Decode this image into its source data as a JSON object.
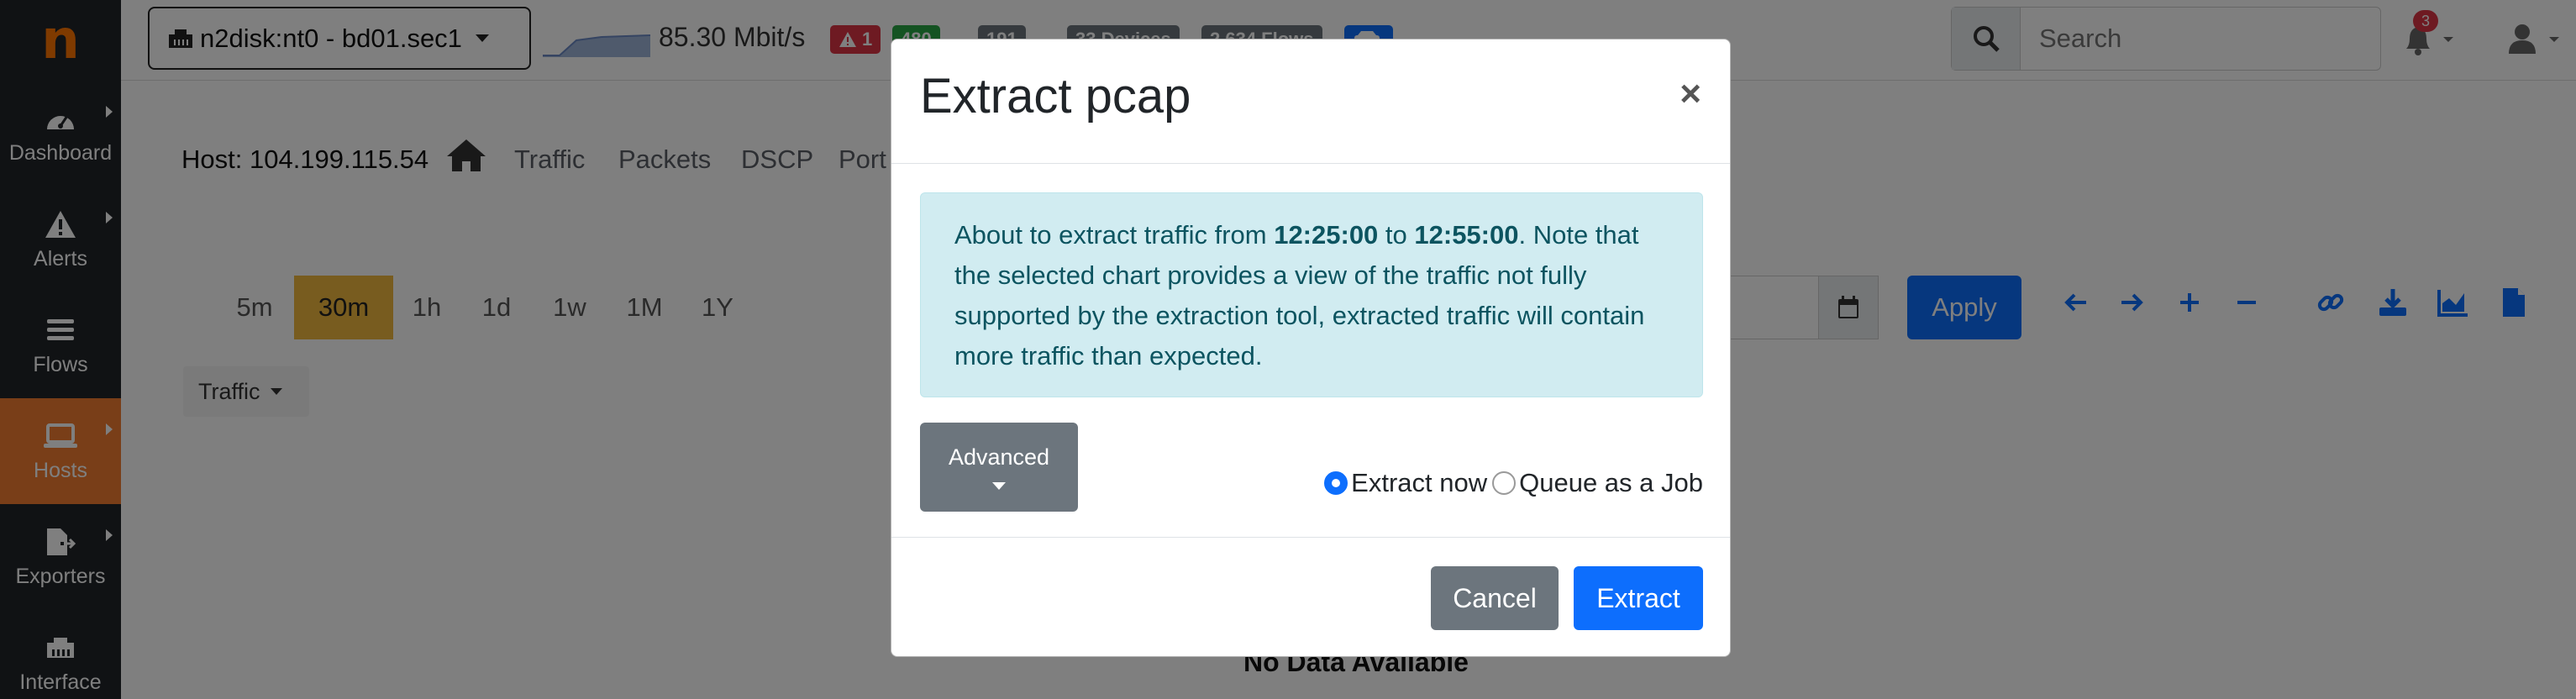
{
  "brand": {
    "logo_letter": "n",
    "color": "#ff7500"
  },
  "sidebar": {
    "items": [
      {
        "label": "Dashboard",
        "icon": "gauge-icon",
        "active": false
      },
      {
        "label": "Alerts",
        "icon": "warning-icon",
        "active": false
      },
      {
        "label": "Flows",
        "icon": "list-icon",
        "active": false
      },
      {
        "label": "Hosts",
        "icon": "laptop-icon",
        "active": true
      },
      {
        "label": "Exporters",
        "icon": "file-export-icon",
        "active": false
      },
      {
        "label": "Interface",
        "icon": "ethernet-icon",
        "active": false
      }
    ]
  },
  "topbar": {
    "interface_selector": "n2disk:nt0 - bd01.sec1",
    "throughput": "85.30 Mbit/s",
    "badges": [
      {
        "label": "1",
        "color": "#dc3545",
        "icon": "warning-icon"
      },
      {
        "label": "480",
        "color": "#28a745"
      },
      {
        "label": "191",
        "color": "#6c757d"
      },
      {
        "label": "33 Devices",
        "color": "#6c757d"
      },
      {
        "label": "2,634 Flows",
        "color": "#6c757d"
      }
    ],
    "search_placeholder": "Search",
    "notifications_count": "3"
  },
  "host": {
    "title": "Host: 104.199.115.54",
    "tabs": [
      "Traffic",
      "Packets",
      "DSCP",
      "Port"
    ]
  },
  "toolbar": {
    "ranges": [
      "5m",
      "30m",
      "1h",
      "1d",
      "1w",
      "1M",
      "1Y"
    ],
    "selected_range": "30m",
    "apply_label": "Apply",
    "traffic_dropdown": "Traffic"
  },
  "chart": {
    "no_data": "No Data Available"
  },
  "modal": {
    "title": "Extract pcap",
    "close_glyph": "×",
    "alert": {
      "prefix": "About to extract traffic from ",
      "start_time": "12:25:00",
      "middle": " to ",
      "end_time": "12:55:00",
      "suffix": ". Note that the selected chart provides a view of the traffic not fully supported by the extraction tool, extracted traffic will contain more traffic than expected."
    },
    "advanced_label": "Advanced",
    "radio_extract_now": "Extract now",
    "radio_queue_job": "Queue as a Job",
    "selected_option": "Extract now",
    "cancel_label": "Cancel",
    "extract_label": "Extract"
  }
}
